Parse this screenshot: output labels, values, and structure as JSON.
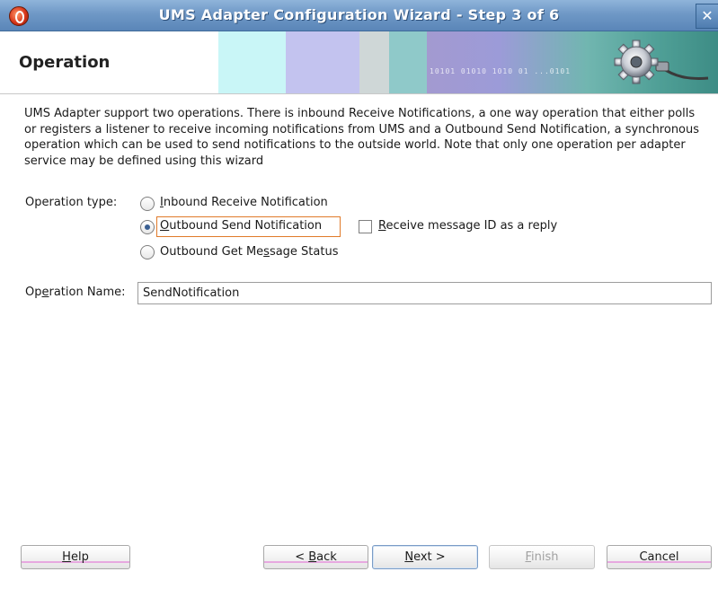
{
  "window": {
    "title": "UMS Adapter Configuration Wizard - Step 3 of 6",
    "close_glyph": "✕"
  },
  "header": {
    "title": "Operation",
    "binary_decoration": "10101  01010  1010  01  ...0101"
  },
  "description": "UMS Adapter support two operations. There is inbound Receive Notifications, a one way operation that either polls or registers a listener to receive incoming notifications from UMS and a Outbound Send Notification, a synchronous operation which can be used to send notifications to the outside world. Note that only one operation per adapter service may be defined using this wizard",
  "operation_type": {
    "label": "Operation type:",
    "options": [
      {
        "mnemonic": "I",
        "rest": "nbound Receive Notification",
        "selected": false
      },
      {
        "mnemonic": "O",
        "rest": "utbound Send Notification",
        "selected": true
      },
      {
        "before": "Outbound Get Me",
        "mnemonic": "s",
        "rest": "sage Status",
        "selected": false
      }
    ]
  },
  "receive_message_id": {
    "mnemonic": "R",
    "rest": "eceive message ID as a reply",
    "checked": false
  },
  "operation_name": {
    "label_before": "Op",
    "label_mnemonic": "e",
    "label_rest": "ration Name:",
    "value": "SendNotification"
  },
  "buttons": {
    "help": {
      "mnemonic": "H",
      "rest": "elp"
    },
    "back": {
      "before": "< ",
      "mnemonic": "B",
      "rest": "ack"
    },
    "next": {
      "mnemonic": "N",
      "rest": "ext >"
    },
    "finish": {
      "mnemonic": "F",
      "rest": "inish",
      "enabled": false
    },
    "cancel": {
      "label": "Cancel"
    }
  },
  "icons": [
    "oracle-app-icon",
    "close-icon",
    "gear-plug-icon"
  ],
  "colors": {
    "titlebar": "#6f98c6",
    "focus_outline": "#e07a2a",
    "button_accent": "#e7a8e0"
  }
}
